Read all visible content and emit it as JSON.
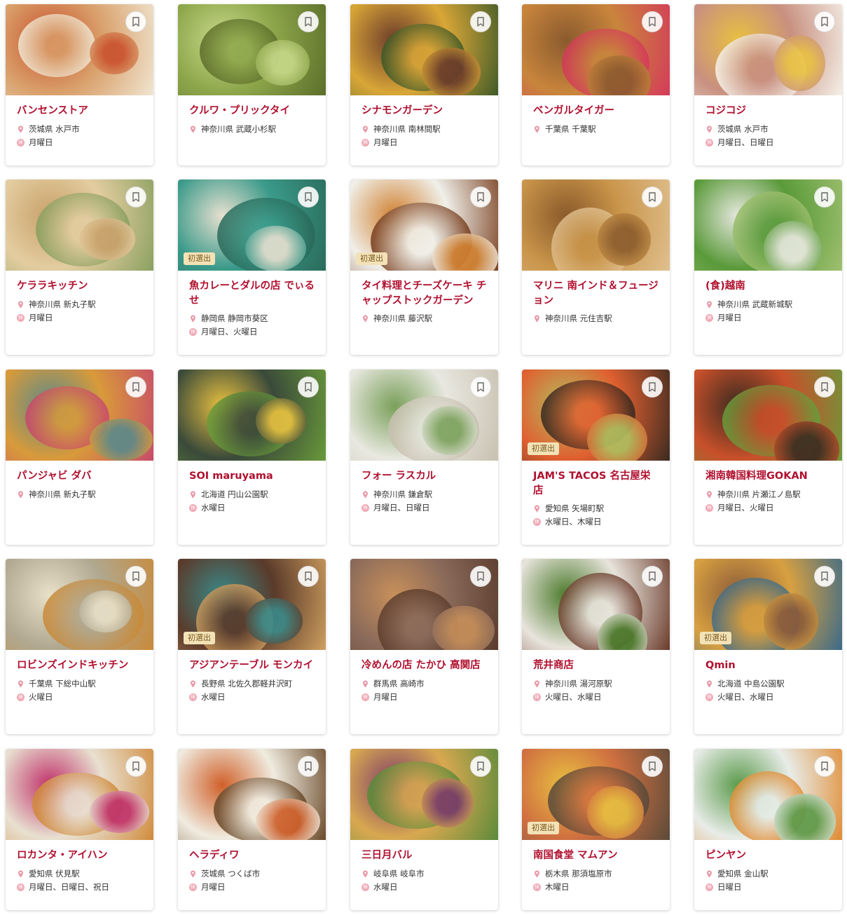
{
  "ui": {
    "badge_label": "初選出",
    "colors": {
      "title": "#b0102f",
      "pin": "#e89aa8",
      "closed_badge": "#f0a9b5",
      "badge_bg": "#f3e2b7"
    },
    "icons": {
      "location": "map-pin-icon",
      "closed": "closed-day-icon",
      "bookmark": "bookmark-icon"
    }
  },
  "restaurants": [
    {
      "name": "バンセンストア",
      "location": "茨城県 水戸市",
      "closed": "月曜日",
      "badge": false,
      "colors": [
        "#d9a06b",
        "#c94f2c",
        "#f0e6d2"
      ]
    },
    {
      "name": "クルワ・プリックタイ",
      "location": "神奈川県 武蔵小杉駅",
      "closed": "",
      "badge": false,
      "colors": [
        "#8da64a",
        "#c7d98a",
        "#5c6e2a"
      ]
    },
    {
      "name": "シナモンガーデン",
      "location": "神奈川県 南林間駅",
      "closed": "月曜日",
      "badge": false,
      "colors": [
        "#d9a637",
        "#6b3b2a",
        "#3e5a28"
      ]
    },
    {
      "name": "ベンガルタイガー",
      "location": "千葉県 千葉駅",
      "closed": "",
      "badge": false,
      "colors": [
        "#c9853c",
        "#8a5a2e",
        "#d43a5a"
      ]
    },
    {
      "name": "コジコジ",
      "location": "茨城県 水戸市",
      "closed": "月曜日、日曜日",
      "badge": false,
      "colors": [
        "#c89080",
        "#e8c040",
        "#f5f0e8"
      ]
    },
    {
      "name": "ケララキッチン",
      "location": "神奈川県 新丸子駅",
      "closed": "月曜日",
      "badge": false,
      "colors": [
        "#e3cda0",
        "#c8a06a",
        "#8aa060"
      ]
    },
    {
      "name": "魚カレーとダルの店 でぃるせ",
      "location": "静岡県 静岡市葵区",
      "closed": "月曜日、火曜日",
      "badge": true,
      "colors": [
        "#3a9a8a",
        "#e8e0d0",
        "#2a6a5a"
      ]
    },
    {
      "name": "タイ料理とチーズケーキ チャップストックガーデン",
      "location": "神奈川県 藤沢駅",
      "closed": "",
      "badge": true,
      "colors": [
        "#f0f0ea",
        "#d08030",
        "#7a4020"
      ]
    },
    {
      "name": "マリニ 南インド＆フュージョン",
      "location": "神奈川県 元住吉駅",
      "closed": "",
      "badge": false,
      "colors": [
        "#c9954a",
        "#8a5a2a",
        "#e0c090"
      ]
    },
    {
      "name": "(食)越南",
      "location": "神奈川県 武蔵新城駅",
      "closed": "月曜日",
      "badge": false,
      "colors": [
        "#5a9a3a",
        "#e8e8e0",
        "#a0c070"
      ]
    },
    {
      "name": "パンジャビ ダバ",
      "location": "神奈川県 新丸子駅",
      "closed": "",
      "badge": false,
      "colors": [
        "#d89a3a",
        "#5a8a8a",
        "#c84a6a"
      ]
    },
    {
      "name": "SOI maruyama",
      "location": "北海道 円山公園駅",
      "closed": "水曜日",
      "badge": false,
      "colors": [
        "#3a4a3a",
        "#e8c040",
        "#6a9a3a"
      ]
    },
    {
      "name": "フォー ラスカル",
      "location": "神奈川県 鎌倉駅",
      "closed": "月曜日、日曜日",
      "badge": false,
      "colors": [
        "#e8e8e0",
        "#7aa05a",
        "#c8c0b0"
      ]
    },
    {
      "name": "JAM'S TACOS 名古屋栄店",
      "location": "愛知県 矢場町駅",
      "closed": "水曜日、木曜日",
      "badge": true,
      "colors": [
        "#e06030",
        "#b0c060",
        "#3a2a20"
      ]
    },
    {
      "name": "湘南韓国料理GOKAN",
      "location": "神奈川県 片瀬江ノ島駅",
      "closed": "月曜日、火曜日",
      "badge": false,
      "colors": [
        "#c8502a",
        "#3a2a20",
        "#6a9a3a"
      ]
    },
    {
      "name": "ロビンズインドキッチン",
      "location": "千葉県 下総中山駅",
      "closed": "火曜日",
      "badge": false,
      "colors": [
        "#b0a890",
        "#e8e0c8",
        "#c88a3a"
      ]
    },
    {
      "name": "アジアンテーブル モンカイ",
      "location": "長野県 北佐久郡軽井沢町",
      "closed": "水曜日",
      "badge": true,
      "colors": [
        "#5a3a2a",
        "#3a8a8a",
        "#d0a060"
      ]
    },
    {
      "name": "冷めんの店 たかひ 高関店",
      "location": "群馬県 高崎市",
      "closed": "月曜日",
      "badge": false,
      "colors": [
        "#8a6a5a",
        "#c8905a",
        "#5a3a2a"
      ]
    },
    {
      "name": "荒井商店",
      "location": "神奈川県 湯河原駅",
      "closed": "火曜日、水曜日",
      "badge": false,
      "colors": [
        "#e8e4dc",
        "#4a7a2a",
        "#6a3a2a"
      ]
    },
    {
      "name": "Qmin",
      "location": "北海道 中島公園駅",
      "closed": "火曜日、水曜日",
      "badge": true,
      "colors": [
        "#d8a040",
        "#8a5a3a",
        "#3a6a8a"
      ]
    },
    {
      "name": "ロカンタ・アイハン",
      "location": "愛知県 伏見駅",
      "closed": "月曜日、日曜日、祝日",
      "badge": false,
      "colors": [
        "#e8e0d0",
        "#c0306a",
        "#d08a3a"
      ]
    },
    {
      "name": "ヘラディワ",
      "location": "茨城県 つくば市",
      "closed": "月曜日",
      "badge": false,
      "colors": [
        "#f0ece0",
        "#d0602a",
        "#6a4a2a"
      ]
    },
    {
      "name": "三日月バル",
      "location": "岐阜県 岐阜市",
      "closed": "水曜日",
      "badge": false,
      "colors": [
        "#d8a850",
        "#7a3a6a",
        "#5a8a3a"
      ]
    },
    {
      "name": "南国食堂 マムアン",
      "location": "栃木県 那須塩原市",
      "closed": "木曜日",
      "badge": true,
      "colors": [
        "#d07040",
        "#e8c040",
        "#5a4a3a"
      ]
    },
    {
      "name": "ピンヤン",
      "location": "愛知県 金山駅",
      "closed": "日曜日",
      "badge": false,
      "colors": [
        "#e8ece8",
        "#5a9a4a",
        "#e08a30"
      ]
    }
  ]
}
